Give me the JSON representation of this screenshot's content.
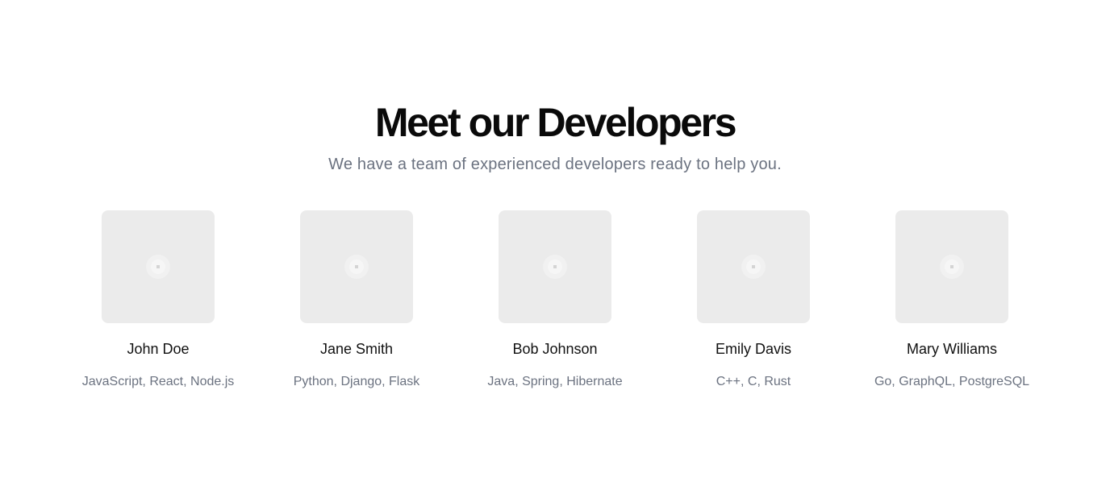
{
  "header": {
    "title": "Meet our Developers",
    "subtitle": "We have a team of experienced developers ready to help you."
  },
  "developers": [
    {
      "name": "John Doe",
      "skills": "JavaScript, React, Node.js",
      "avatar_icon": "image-placeholder-icon"
    },
    {
      "name": "Jane Smith",
      "skills": "Python, Django, Flask",
      "avatar_icon": "image-placeholder-icon"
    },
    {
      "name": "Bob Johnson",
      "skills": "Java, Spring, Hibernate",
      "avatar_icon": "image-placeholder-icon"
    },
    {
      "name": "Emily Davis",
      "skills": "C++, C, Rust",
      "avatar_icon": "image-placeholder-icon"
    },
    {
      "name": "Mary Williams",
      "skills": "Go, GraphQL, PostgreSQL",
      "avatar_icon": "image-placeholder-icon"
    }
  ],
  "colors": {
    "background": "#ffffff",
    "heading": "#0a0a0a",
    "muted_text": "#6b7280",
    "avatar_bg": "#ebebeb"
  }
}
